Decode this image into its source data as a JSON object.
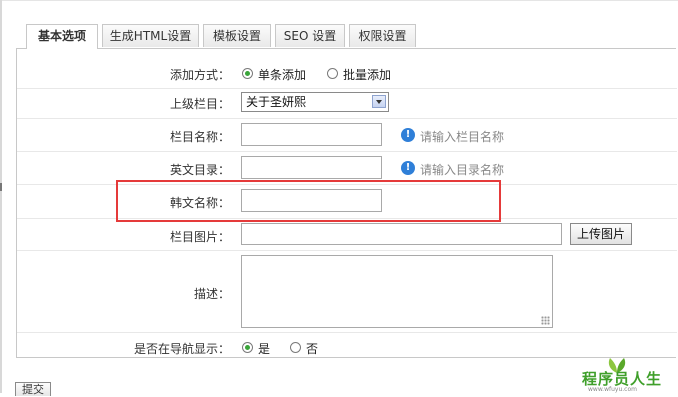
{
  "tabs": [
    {
      "label": "基本选项",
      "active": true
    },
    {
      "label": "生成HTML设置",
      "active": false
    },
    {
      "label": "模板设置",
      "active": false
    },
    {
      "label": "SEO 设置",
      "active": false
    },
    {
      "label": "权限设置",
      "active": false
    }
  ],
  "form": {
    "add_mode": {
      "label": "添加方式：",
      "options": [
        {
          "label": "单条添加",
          "selected": true
        },
        {
          "label": "批量添加",
          "selected": false
        }
      ]
    },
    "parent_column": {
      "label": "上级栏目：",
      "value": "关于圣妍熙"
    },
    "column_name": {
      "label": "栏目名称：",
      "value": "",
      "hint": "请输入栏目名称"
    },
    "english_dir": {
      "label": "英文目录：",
      "value": "",
      "hint": "请输入目录名称"
    },
    "alt_name": {
      "label": "韩文名称：",
      "value": ""
    },
    "column_image": {
      "label": "栏目图片：",
      "value": "",
      "upload_label": "上传图片"
    },
    "description": {
      "label": "描述：",
      "value": ""
    },
    "show_in_nav": {
      "label": "是否在导航显示：",
      "options": [
        {
          "label": "是",
          "selected": true
        },
        {
          "label": "否",
          "selected": false
        }
      ]
    }
  },
  "bottom_button": {
    "label": "提交"
  },
  "watermark": {
    "text": "程序员人生",
    "sub": "www.wfuyu.com",
    "color": "#3f9f2a"
  },
  "colors": {
    "highlight": "#e53a3a",
    "info": "#2f7fd8",
    "radio_on": "#3aa53a"
  }
}
